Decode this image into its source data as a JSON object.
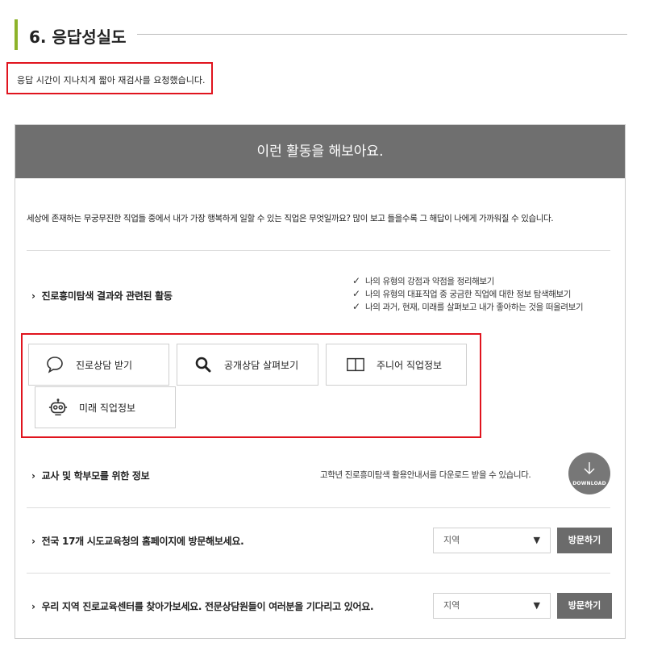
{
  "section": {
    "title": "6. 응답성실도"
  },
  "notice": {
    "text": "응답 시간이 지나치게 짧아 재검사를 요청했습니다."
  },
  "panel": {
    "header": "이런 활동을 해보아요.",
    "intro": "세상에 존재하는 무궁무진한 직업들 중에서 내가 가장 행복하게 일할 수 있는 직업은 무엇일까요? 많이 보고 들을수록 그 해답이 나에게 가까워질 수 있습니다.",
    "activities": {
      "title": "진로흥미탐색 결과와 관련된 활동",
      "checks": [
        "나의 유형의 강점과 약점을 정리해보기",
        "나의 유형의 대표직업 중 궁금한 직업에 대한 정보 탐색해보기",
        "나의 과거, 현재, 미래를 살펴보고 내가 좋아하는 것을 떠올려보기"
      ],
      "buttons": [
        {
          "label": "진로상담 받기",
          "icon": "speech-bubble-icon"
        },
        {
          "label": "공개상담 살펴보기",
          "icon": "search-icon"
        },
        {
          "label": "주니어 직업정보",
          "icon": "book-icon"
        },
        {
          "label": "미래 직업정보",
          "icon": "robot-icon"
        }
      ]
    },
    "teacher": {
      "title": "교사 및 학부모를 위한 정보",
      "note": "고학년 진로흥미탐색 활용안내서를 다운로드 받을 수 있습니다.",
      "download_label": "DOWNLOAD"
    },
    "provincial": {
      "title": "전국 17개 시도교육청의 홈페이지에 방문해보세요.",
      "select": "지역",
      "visit": "방문하기"
    },
    "local": {
      "title": "우리 지역 진로교육센터를 찾아가보세요. 전문상담원들이 여러분을 기다리고 있어요.",
      "select": "지역",
      "visit": "방문하기"
    }
  },
  "colors": {
    "accent": "#8db32a",
    "highlight": "#e0141e",
    "header_bg": "#6f6f6f",
    "button_bg": "#6b6b6b"
  }
}
